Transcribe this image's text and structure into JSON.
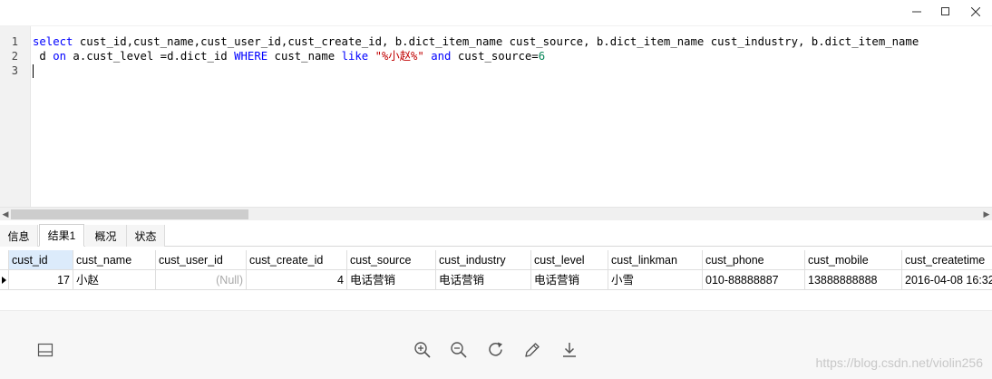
{
  "editor": {
    "line_numbers": [
      "1",
      "2",
      "3"
    ],
    "line1": {
      "select": "select",
      "cols": " cust_id,cust_name,cust_user_id,cust_create_id, b.dict_item_name cust_source, b.dict_item_name cust_industry, b.dict_item_name"
    },
    "line2": {
      "pre": " d ",
      "on": "on",
      "mid": " a.cust_level =d.dict_id ",
      "where": "WHERE",
      "mid2": " cust_name ",
      "like": "like",
      "sp": " ",
      "str": "\"%小赵%\"",
      "sp2": " ",
      "and": "and",
      "mid3": " cust_source=",
      "num": "6"
    }
  },
  "tabs": [
    "信息",
    "结果1",
    "概况",
    "状态"
  ],
  "grid": {
    "columns": [
      "cust_id",
      "cust_name",
      "cust_user_id",
      "cust_create_id",
      "cust_source",
      "cust_industry",
      "cust_level",
      "cust_linkman",
      "cust_phone",
      "cust_mobile",
      "cust_createtime"
    ],
    "rows": [
      [
        "17",
        "小赵",
        "(Null)",
        "4",
        "电话营销",
        "电话营销",
        "电话营销",
        "小雪",
        "010-88888887",
        "13888888888",
        "2016-04-08 16:32"
      ]
    ]
  },
  "watermark": "https://blog.csdn.net/violin256",
  "icons": {
    "minimize": "minimize-icon",
    "maximize": "maximize-icon",
    "close": "close-icon",
    "panel": "panel-layout-icon",
    "zoom_in": "zoom-in-icon",
    "zoom_out": "zoom-out-icon",
    "refresh": "refresh-icon",
    "edit": "pencil-icon",
    "download": "download-icon"
  }
}
